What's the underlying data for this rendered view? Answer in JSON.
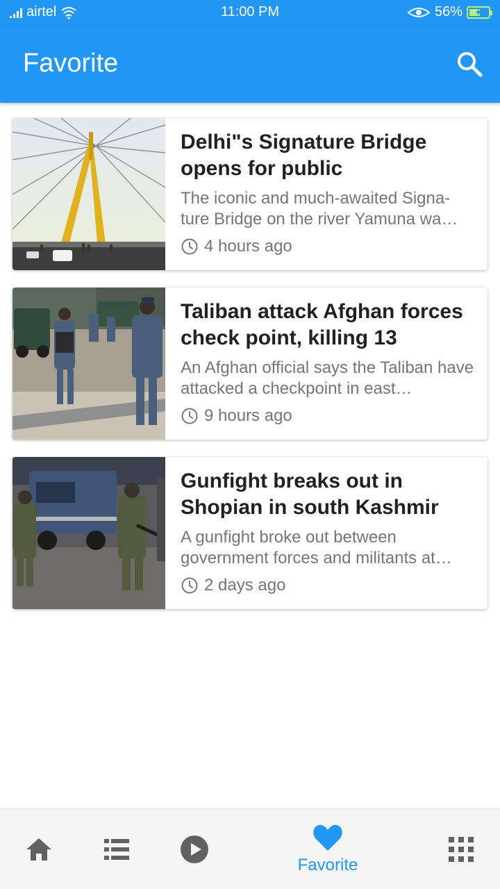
{
  "status_bar": {
    "carrier": "airtel",
    "time": "11:00 PM",
    "battery": "56%",
    "battery_level": 0.56
  },
  "app_bar": {
    "title": "Favorite",
    "search_icon": "search-icon"
  },
  "articles": [
    {
      "title": "Delhi\"s Signature Bridge opens for public",
      "description": "The iconic and much-awaited Signa-ture Bridge on the river Yamuna wa…",
      "time": "4 hours ago"
    },
    {
      "title": "Taliban attack Afghan forces check point, killing 13",
      "description": "An Afghan official says the Taliban have attacked a checkpoint in east…",
      "time": "9 hours ago"
    },
    {
      "title": "Gunfight breaks out in Shopian in south Kashmir",
      "description": "A gunfight broke out between government forces and militants at…",
      "time": "2 days ago"
    }
  ],
  "bottom_nav": {
    "items": [
      {
        "icon": "home-icon"
      },
      {
        "icon": "list-icon"
      },
      {
        "icon": "play-icon"
      },
      {
        "icon": "heart-icon",
        "label": "Favorite",
        "active": true
      },
      {
        "icon": "apps-grid-icon"
      }
    ]
  },
  "colors": {
    "primary": "#2196f3",
    "title_text": "#212121",
    "secondary_text": "#757575",
    "inactive_icon": "#616161"
  }
}
